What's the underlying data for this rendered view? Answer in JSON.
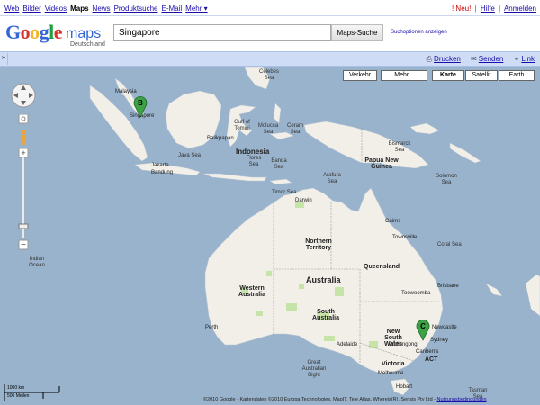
{
  "nav": {
    "left": [
      {
        "name": "nav-web",
        "label": "Web"
      },
      {
        "name": "nav-bilder",
        "label": "Bilder"
      },
      {
        "name": "nav-videos",
        "label": "Videos"
      },
      {
        "name": "nav-maps",
        "label": "Maps",
        "active": true
      },
      {
        "name": "nav-news",
        "label": "News"
      },
      {
        "name": "nav-produktsuche",
        "label": "Produktsuche"
      },
      {
        "name": "nav-email",
        "label": "E-Mail"
      },
      {
        "name": "nav-mehr",
        "label": "Mehr ▾"
      }
    ],
    "new_badge": "! Neu!",
    "help": "Hilfe",
    "signin": "Anmelden"
  },
  "header": {
    "logo_text": "Google",
    "maps_word": "maps",
    "locale": "Deutschland",
    "search_value": "Singapore",
    "search_button": "Maps-Suche",
    "search_options": "Suchoptionen anzeigen"
  },
  "toolbar": {
    "collapse": "»",
    "print": "Drucken",
    "send": "Senden",
    "link": "Link"
  },
  "map_types": {
    "traffic": "Verkehr",
    "more": "Mehr...",
    "map": "Karte",
    "satellite": "Satellit",
    "earth": "Earth"
  },
  "markers": {
    "b": "B",
    "c": "C"
  },
  "labels": {
    "malaysia": "Malaysia",
    "singapore": "Singapore",
    "java_sea": "Java Sea",
    "jakarta": "Jakarta",
    "bandung": "Bandung",
    "gulf_of_tomini": "Gulf of Tomini",
    "celebes_sea": "Celebes Sea",
    "molucca_sea": "Molucca Sea",
    "ceram_sea": "Ceram Sea",
    "banda_sea": "Banda Sea",
    "flores_sea": "Flores Sea",
    "indonesia": "Indonesia",
    "balikpapan": "Balikpapan",
    "papua_new_guinea": "Papua New Guinea",
    "bismarck_sea": "Bismarck Sea",
    "solomon_sea": "Solomon Sea",
    "arafura_sea": "Arafura Sea",
    "timor_sea": "Timor Sea",
    "coral_sea": "Coral Sea",
    "northern_territory": "Northern Territory",
    "queensland": "Queensland",
    "western_australia": "Western Australia",
    "australia": "Australia",
    "south_australia": "South Australia",
    "new_south_wales": "New South Wales",
    "victoria": "Victoria",
    "act": "ACT",
    "great_australian_bight": "Great Australian Bight",
    "indian_ocean": "Indian Ocean",
    "tasman_sea": "Tasman Sea",
    "toowoomba": "Toowoomba",
    "brisbane": "Brisbane",
    "wollongong": "Wollongong",
    "sydney": "Sydney",
    "canberra": "Canberra",
    "adelaide": "Adelaide",
    "melbourne": "Melbourne",
    "perth": "Perth",
    "darwin": "Darwin",
    "cairns": "Cairns",
    "townsville": "Townsville",
    "newcastle": "Newcastle",
    "hobart": "Hobart"
  },
  "scale": {
    "km": "1000 km",
    "miles": "500 Meilen"
  },
  "copyright": "©2010 Google - Kartendaten ©2010 Europa Technologies, MapIT, Tele Atlas, Whereis(R), Sensis Pty Ltd -",
  "terms": "Nutzungsbedingungen",
  "colors": {
    "water": "#99b3cc",
    "land": "#f2efe9",
    "park": "#c6e3a8",
    "marker": "#3da146"
  }
}
